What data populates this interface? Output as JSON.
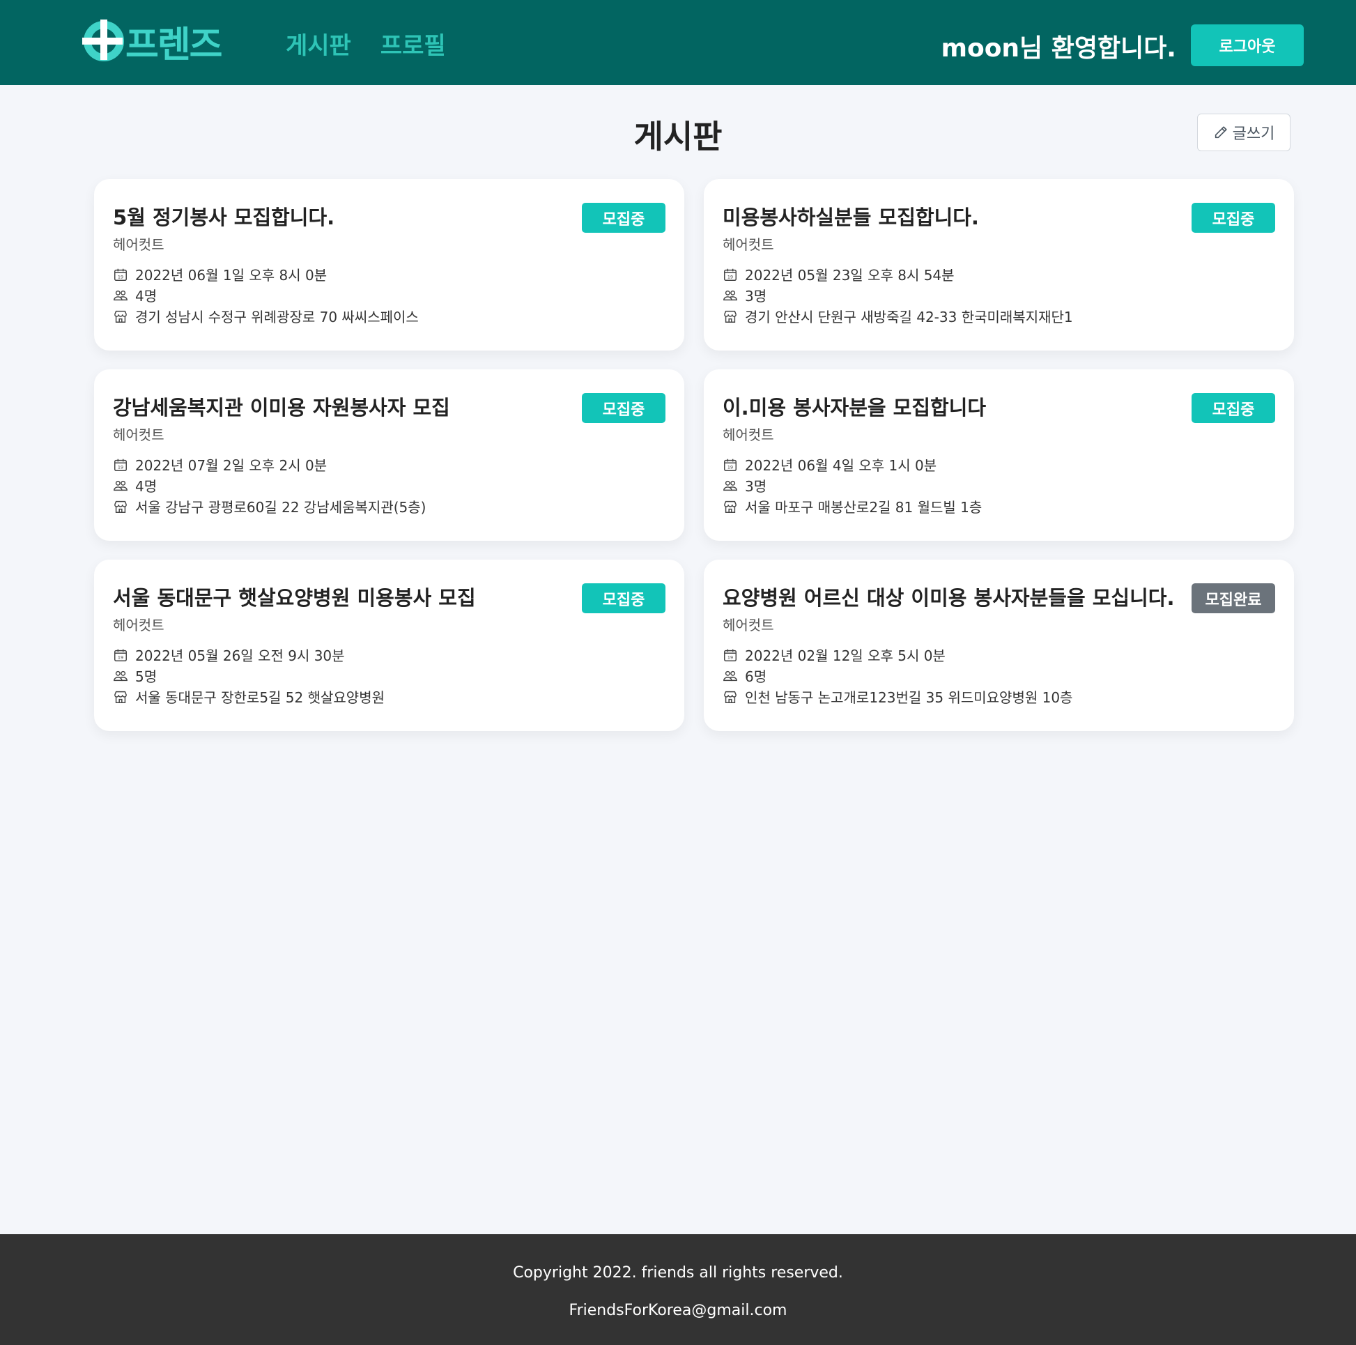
{
  "header": {
    "logo_text": "프렌즈",
    "nav": [
      {
        "label": "게시판"
      },
      {
        "label": "프로필"
      }
    ],
    "welcome_text": "moon님 환영합니다.",
    "logout_label": "로그아웃"
  },
  "main": {
    "title": "게시판",
    "write_label": "글쓰기",
    "posts": [
      {
        "title": "5월 정기봉사 모집합니다.",
        "category": "헤어컷트",
        "status": "모집중",
        "date": "2022년 06월 1일 오후 8시 0분",
        "people": "4명",
        "place": "경기 성남시 수정구 위례광장로 70 싸씨스페이스"
      },
      {
        "title": "미용봉사하실분들 모집합니다.",
        "category": "헤어컷트",
        "status": "모집중",
        "date": "2022년 05월 23일 오후 8시 54분",
        "people": "3명",
        "place": "경기 안산시 단원구 새방죽길 42-33 한국미래복지재단1"
      },
      {
        "title": "강남세움복지관 이미용 자원봉사자 모집",
        "category": "헤어컷트",
        "status": "모집중",
        "date": "2022년 07월 2일 오후 2시 0분",
        "people": "4명",
        "place": "서울 강남구 광평로60길 22 강남세움복지관(5층)"
      },
      {
        "title": "이.미용 봉사자분을 모집합니다",
        "category": "헤어컷트",
        "status": "모집중",
        "date": "2022년 06월 4일 오후 1시 0분",
        "people": "3명",
        "place": "서울 마포구 매봉산로2길 81 월드빌 1층"
      },
      {
        "title": "서울 동대문구 햇살요양병원 미용봉사 모집",
        "category": "헤어컷트",
        "status": "모집중",
        "date": "2022년 05월 26일 오전 9시 30분",
        "people": "5명",
        "place": "서울 동대문구 장한로5길 52 햇살요양병원"
      },
      {
        "title": "요양병원 어르신 대상 이미용 봉사자분들을 모십니다.",
        "category": "헤어컷트",
        "status": "모집완료",
        "date": "2022년 02월 12일 오후 5시 0분",
        "people": "6명",
        "place": "인천 남동구 논고개로123번길 35 위드미요양병원 10층"
      }
    ]
  },
  "footer": {
    "copyright": "Copyright 2022. friends all rights reserved.",
    "email": "FriendsForKorea@gmail.com"
  },
  "colors": {
    "header_bg": "#026561",
    "accent": "#12c4b8",
    "status_open": "#12c4b8",
    "status_closed": "#6b737b",
    "footer_bg": "#333333"
  },
  "icons": {
    "date": "calendar-icon",
    "people": "people-icon",
    "place": "shop-icon",
    "write": "pencil-icon"
  }
}
